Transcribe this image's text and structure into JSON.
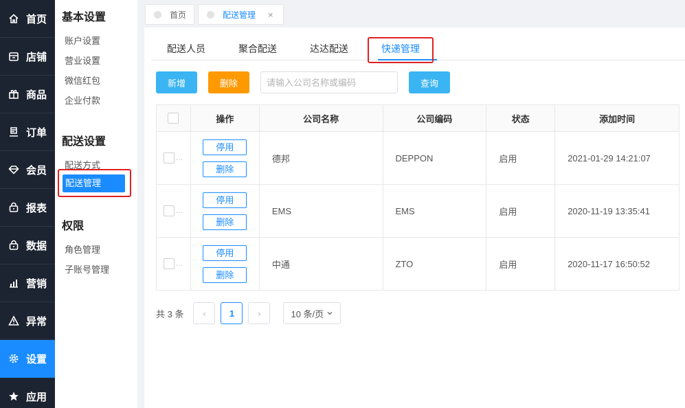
{
  "nav": {
    "items": [
      {
        "label": "首页",
        "icon": "home-icon"
      },
      {
        "label": "店铺",
        "icon": "store-icon"
      },
      {
        "label": "商品",
        "icon": "gift-icon"
      },
      {
        "label": "订单",
        "icon": "order-icon"
      },
      {
        "label": "会员",
        "icon": "member-icon"
      },
      {
        "label": "报表",
        "icon": "report-icon"
      },
      {
        "label": "数据",
        "icon": "data-icon"
      },
      {
        "label": "营销",
        "icon": "bar-chart-icon"
      },
      {
        "label": "异常",
        "icon": "warning-icon"
      },
      {
        "label": "设置",
        "icon": "gear-icon"
      },
      {
        "label": "应用",
        "icon": "star-icon"
      }
    ],
    "active": "设置"
  },
  "submenu": {
    "groups": [
      {
        "title": "基本设置",
        "items": [
          "账户设置",
          "营业设置",
          "微信红包",
          "企业付款"
        ]
      },
      {
        "title": "配送设置",
        "items": [
          "配送方式",
          "配送管理"
        ]
      },
      {
        "title": "权限",
        "items": [
          "角色管理",
          "子账号管理"
        ]
      }
    ],
    "active": "配送管理"
  },
  "tabs": [
    {
      "label": "首页"
    },
    {
      "label": "配送管理",
      "close": "×"
    }
  ],
  "subtabs": [
    "配送人员",
    "聚合配送",
    "达达配送",
    "快递管理"
  ],
  "toolbar": {
    "add_label": "新增",
    "delete_label": "删除",
    "search_placeholder": "请输入公司名称或编码",
    "query_label": "查询"
  },
  "table": {
    "columns": [
      "操作",
      "公司名称",
      "公司编码",
      "状态",
      "添加时间"
    ],
    "ellipsis": "…",
    "op_labels": [
      "停用",
      "删除"
    ],
    "rows": [
      {
        "name": "德邦",
        "code": "DEPPON",
        "status": "启用",
        "time": "2021-01-29 14:21:07"
      },
      {
        "name": "EMS",
        "code": "EMS",
        "status": "启用",
        "time": "2020-11-19 13:35:41"
      },
      {
        "name": "中通",
        "code": "ZTO",
        "status": "启用",
        "time": "2020-11-17 16:50:52"
      }
    ]
  },
  "pager": {
    "total": "共 3 条",
    "prev": "‹",
    "current": "1",
    "next": "›",
    "page_size": "10 条/页"
  },
  "colors": {
    "accent": "#1a8cff",
    "nav_bg": "#1c2431",
    "btn_blue": "#3ab4f2",
    "btn_orange": "#ff9900",
    "highlight": "#e02020"
  }
}
